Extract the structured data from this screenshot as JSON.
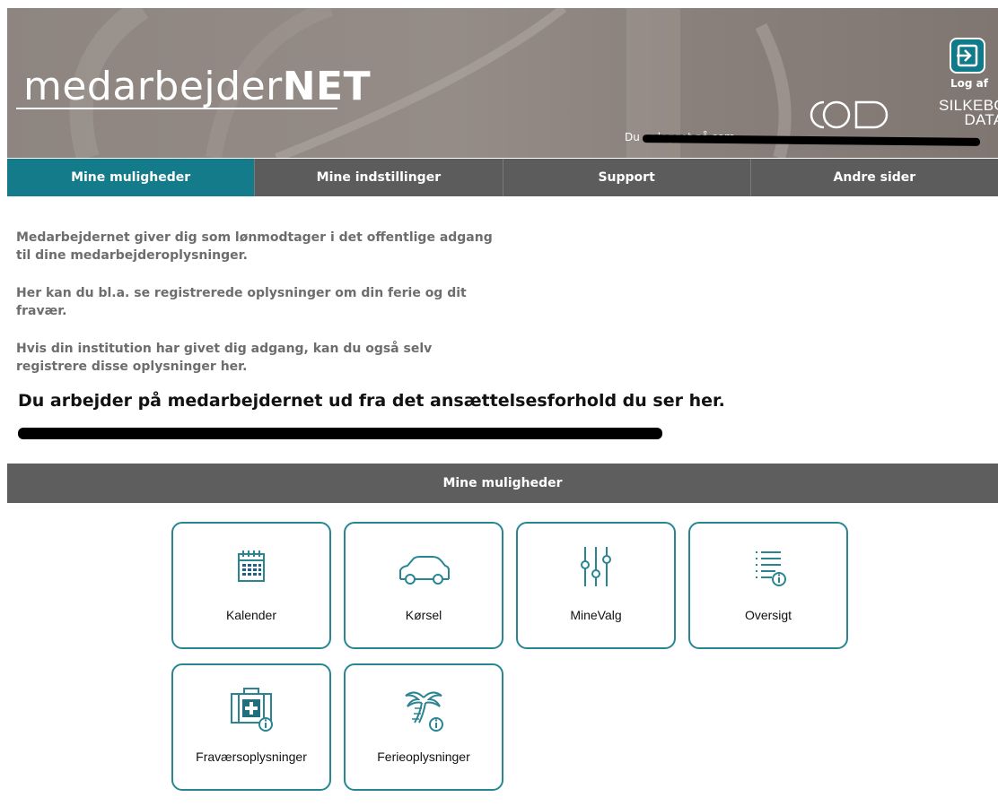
{
  "header": {
    "brand_light": "medarbejder",
    "brand_bold": "NET",
    "logout_label": "Log af",
    "company_line1": "SILKEBORG",
    "company_line2": "DATA",
    "logged_in_text": "Du er logget på som"
  },
  "nav": {
    "tabs": [
      {
        "label": "Mine muligheder",
        "active": true
      },
      {
        "label": "Mine indstillinger",
        "active": false
      },
      {
        "label": "Support",
        "active": false
      },
      {
        "label": "Andre sider",
        "active": false
      }
    ]
  },
  "intro": {
    "paragraphs": [
      "Medarbejdernet giver dig som lønmodtager i det offentlige adgang til dine medarbejderoplysninger.",
      "Her kan du bl.a. se registrerede oplysninger om din ferie og dit fravær.",
      "Hvis din institution har givet dig adgang, kan du også selv registrere disse oplysninger her."
    ],
    "headline": "Du arbejder på medarbejdernet ud fra det ansættelsesforhold du ser her."
  },
  "section": {
    "title": "Mine muligheder"
  },
  "tiles": [
    {
      "label": "Kalender",
      "icon": "calendar-icon"
    },
    {
      "label": "Kørsel",
      "icon": "car-icon"
    },
    {
      "label": "MineValg",
      "icon": "sliders-icon"
    },
    {
      "label": "Oversigt",
      "icon": "list-info-icon"
    },
    {
      "label": "Fraværsoplysninger",
      "icon": "first-aid-kit-icon"
    },
    {
      "label": "Ferieoplysninger",
      "icon": "palm-tree-icon"
    }
  ],
  "colors": {
    "accent": "#137b8a",
    "tile_border": "#2a8593",
    "nav_bg": "#5c5c5c",
    "banner_bg": "#8e8580"
  }
}
